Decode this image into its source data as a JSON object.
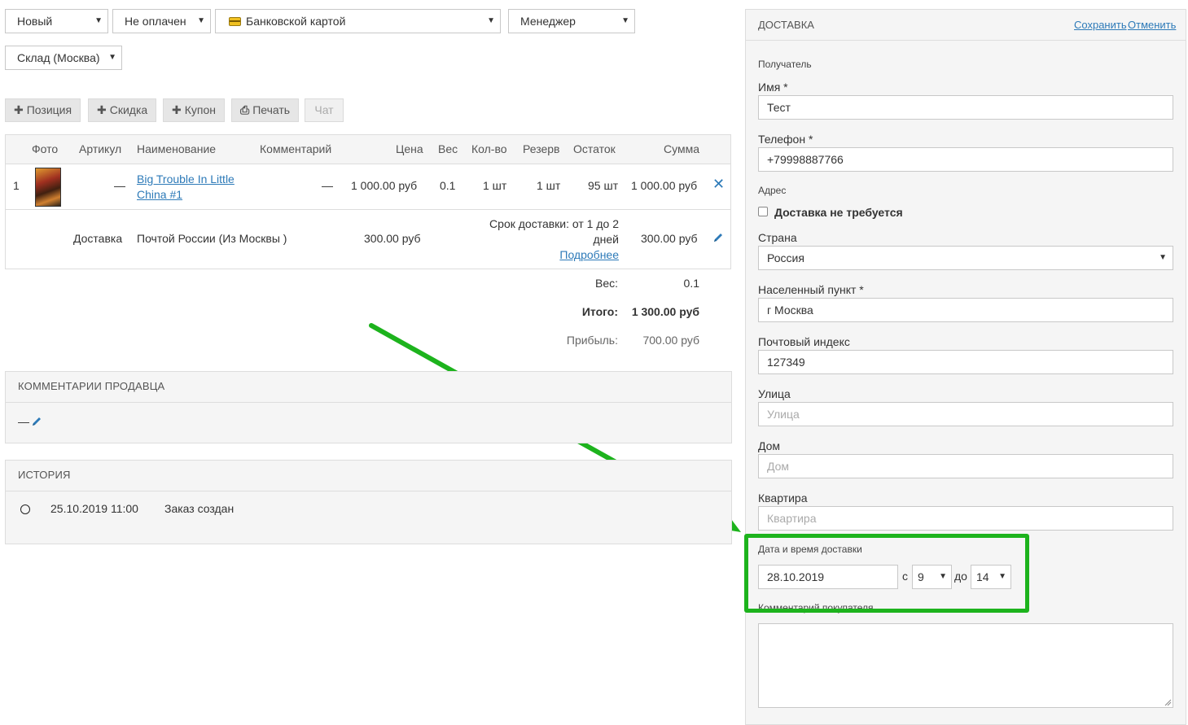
{
  "filters": {
    "status": "Новый",
    "payment_status": "Не оплачен",
    "payment_method": "Банковской картой",
    "manager": "Менеджер",
    "warehouse": "Склад (Москва)"
  },
  "toolbar": {
    "position_label": "Позиция",
    "discount_label": "Скидка",
    "coupon_label": "Купон",
    "print_label": "Печать",
    "chat_label": "Чат"
  },
  "table": {
    "headers": {
      "photo": "Фото",
      "sku": "Артикул",
      "name": "Наименование",
      "comment": "Комментарий",
      "price": "Цена",
      "weight": "Вес",
      "qty": "Кол-во",
      "reserve": "Резерв",
      "stock": "Остаток",
      "sum": "Сумма"
    },
    "rows": [
      {
        "num": "1",
        "sku": "—",
        "name_line1": "Big Trouble In Little",
        "name_line2": "China #1",
        "comment": "—",
        "price": "1 000.00 руб",
        "weight": "0.1",
        "qty": "1 шт",
        "reserve": "1 шт",
        "stock": "95 шт",
        "sum": "1 000.00 руб"
      }
    ],
    "delivery": {
      "label": "Доставка",
      "method": "Почтой России (Из Москвы  )",
      "price": "300.00 руб",
      "term_line1": "Срок доставки: от 1 до 2",
      "term_line2": "дней",
      "more_link": "Подробнее",
      "sum": "300.00 руб"
    }
  },
  "totals": {
    "weight_label": "Вес:",
    "weight_value": "0.1",
    "total_label": "Итого:",
    "total_value": "1 300.00 руб",
    "profit_label": "Прибыль:",
    "profit_value": "700.00 руб"
  },
  "seller_comments": {
    "title": "КОММЕНТАРИИ ПРОДАВЦА",
    "value": "—"
  },
  "history": {
    "title": "ИСТОРИЯ",
    "items": [
      {
        "date": "25.10.2019 11:00",
        "text": "Заказ создан"
      }
    ]
  },
  "delivery_panel": {
    "title": "ДОСТАВКА",
    "save_label": "Сохранить",
    "cancel_label": "Отменить",
    "recipient_label": "Получатель",
    "name_label": "Имя *",
    "name_value": "Тест",
    "phone_label": "Телефон *",
    "phone_value": "+79998887766",
    "address_label": "Адрес",
    "no_delivery_label": "Доставка не требуется",
    "country_label": "Страна",
    "country_value": "Россия",
    "city_label": "Населенный пункт *",
    "city_value": "г Москва",
    "zip_label": "Почтовый индекс",
    "zip_value": "127349",
    "street_label": "Улица",
    "street_placeholder": "Улица",
    "house_label": "Дом",
    "house_placeholder": "Дом",
    "apt_label": "Квартира",
    "apt_placeholder": "Квартира",
    "datetime_label": "Дата и время доставки",
    "date_value": "28.10.2019",
    "from_label": "с",
    "from_value": "9",
    "to_label": "до",
    "to_value": "14",
    "customer_comment_label": "Комментарий покупателя"
  },
  "colors": {
    "accent_green": "#1db31d",
    "link_blue": "#2d7ab8"
  }
}
